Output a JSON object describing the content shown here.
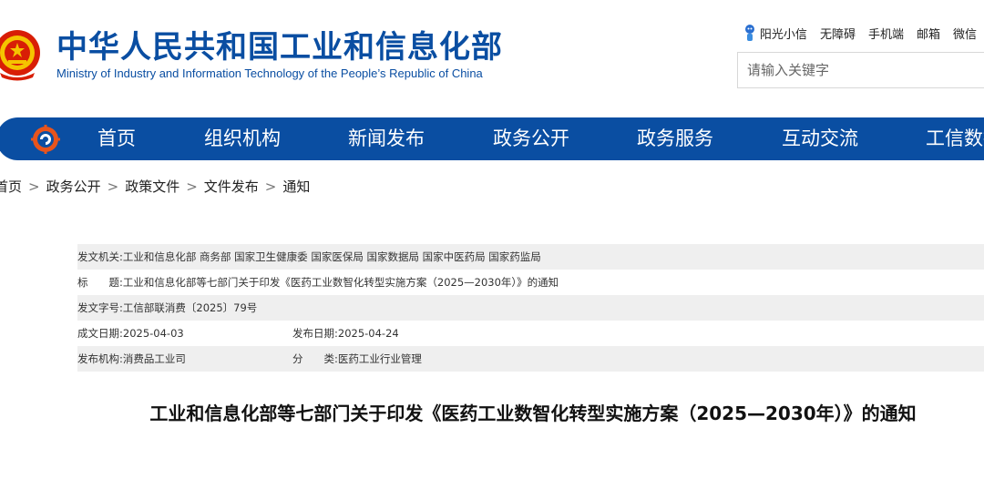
{
  "header": {
    "site_name_cn": "中华人民共和国工业和信息化部",
    "site_name_en": "Ministry of Industry and Information Technology of the People’s Republic of China",
    "links": [
      "阳光小信",
      "无障碍",
      "手机端",
      "邮箱",
      "微信"
    ],
    "search_placeholder": "请输入关键字"
  },
  "nav": {
    "items": [
      "首页",
      "组织机构",
      "新闻发布",
      "政务公开",
      "政务服务",
      "互动交流",
      "工信数据"
    ]
  },
  "breadcrumb": [
    "首页",
    "政务公开",
    "政策文件",
    "文件发布",
    "通知"
  ],
  "info": {
    "issuer_label": "发文机关:",
    "issuer_value": "工业和信息化部 商务部 国家卫生健康委 国家医保局 国家数据局 国家中医药局 国家药监局",
    "title_label": "标　　题:",
    "title_value": "工业和信息化部等七部门关于印发《医药工业数智化转型实施方案（2025—2030年）》的通知",
    "docno_label": "发文字号:",
    "docno_value": "工信部联消费〔2025〕79号",
    "date_label": "成文日期:",
    "date_value": "2025-04-03",
    "publish_label": "发布日期:",
    "publish_value": "2025-04-24",
    "org_label": "发布机构:",
    "org_value": "消费品工业司",
    "category_label": "分　　类:",
    "category_value": "医药工业行业管理"
  },
  "document": {
    "title": "工业和信息化部等七部门关于印发《医药工业数智化转型实施方案（2025—2030年）》的通知"
  },
  "colors": {
    "brand_blue": "#0a4ea2",
    "row_shade": "#efefef"
  }
}
